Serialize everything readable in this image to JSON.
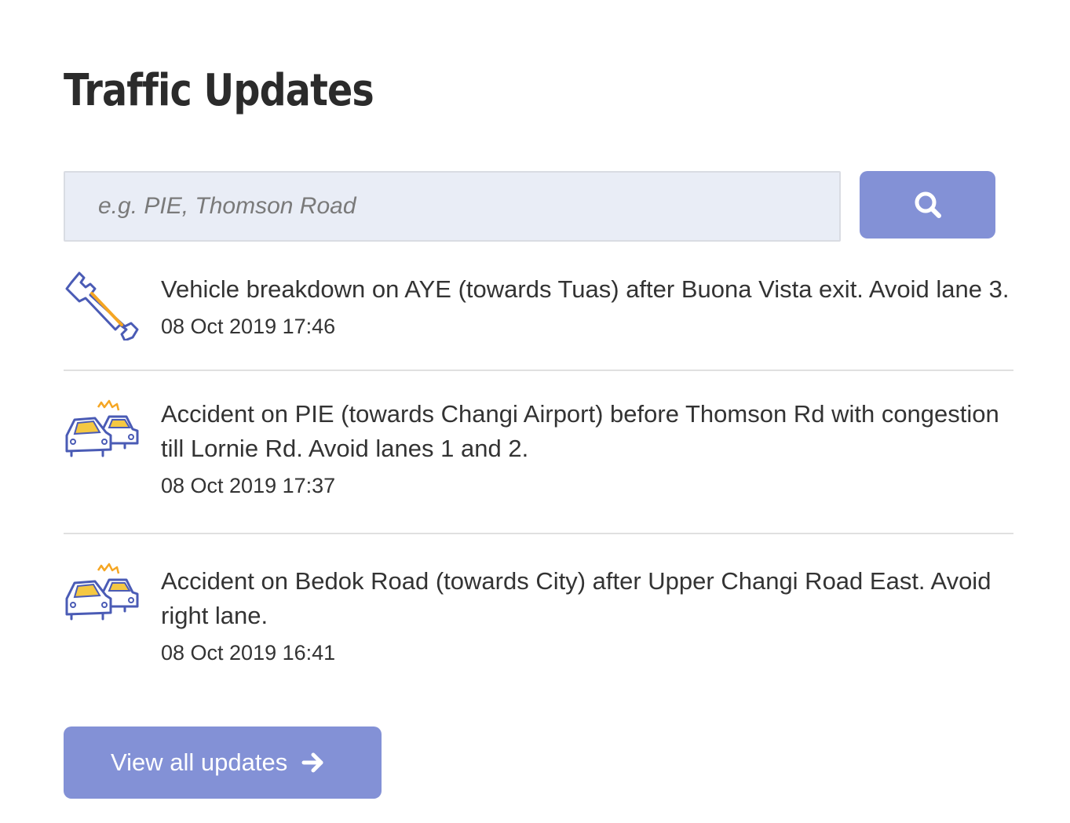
{
  "header": {
    "title": "Traffic Updates"
  },
  "search": {
    "placeholder": "e.g. PIE, Thomson Road",
    "button_icon": "search-icon"
  },
  "updates": [
    {
      "icon": "wrench-icon",
      "text": "Vehicle breakdown on AYE (towards Tuas) after Buona Vista exit. Avoid lane 3.",
      "time": "08 Oct 2019 17:46"
    },
    {
      "icon": "car-accident-icon",
      "text": "Accident on PIE (towards Changi Airport) before Thomson Rd with congestion till Lornie Rd. Avoid lanes 1 and 2.",
      "time": "08 Oct 2019 17:37"
    },
    {
      "icon": "car-accident-icon",
      "text": "Accident on Bedok Road (towards City) after Upper Changi Road East. Avoid right lane.",
      "time": "08 Oct 2019 16:41"
    }
  ],
  "footer": {
    "view_all_label": "View all updates",
    "view_all_icon": "arrow-right-icon"
  },
  "colors": {
    "accent": "#8391d6",
    "icon_outline": "#4a5bb5",
    "icon_highlight": "#f5a623",
    "input_bg": "#e9edf6"
  }
}
